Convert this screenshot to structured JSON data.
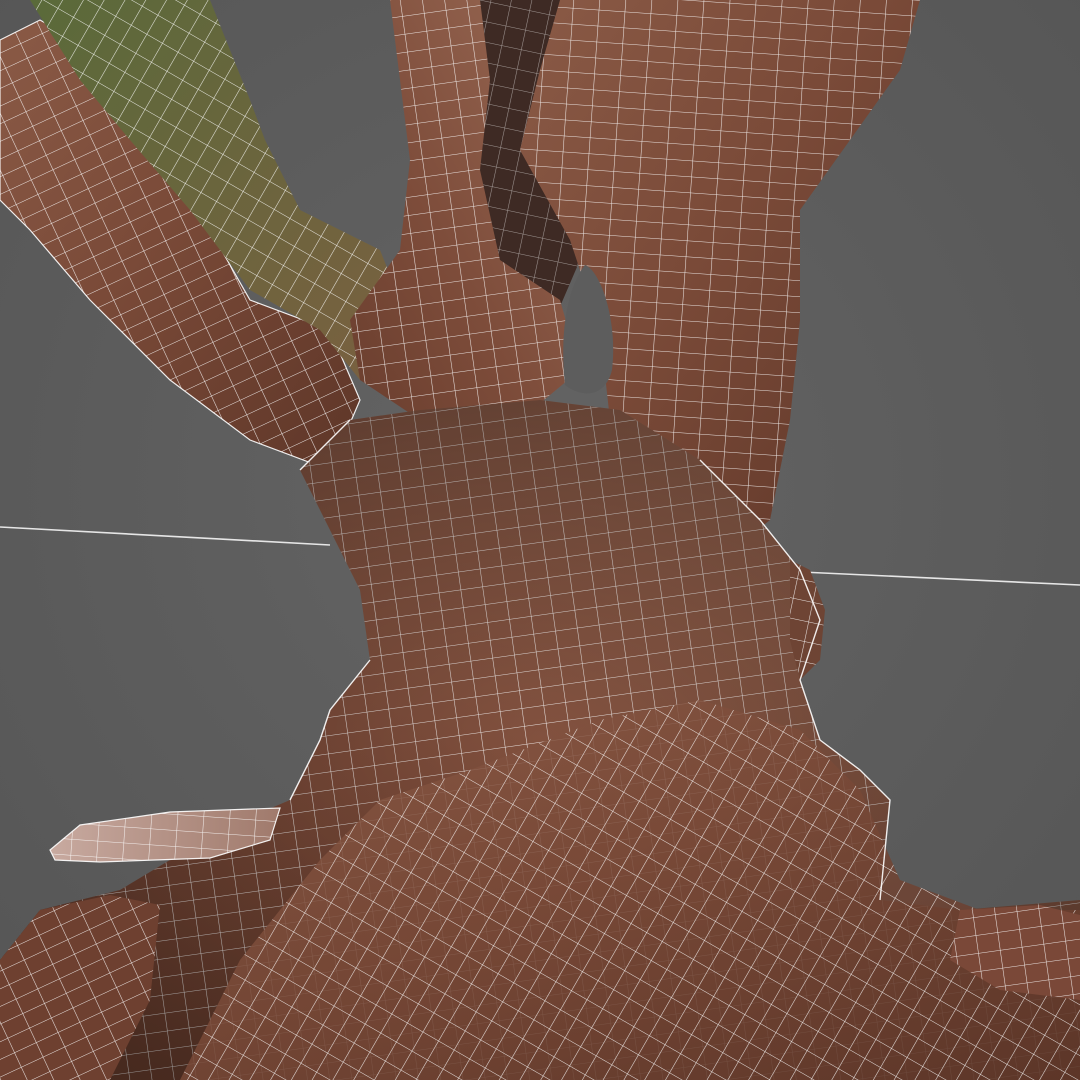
{
  "viewport": {
    "background_color": "#5b5b5b",
    "horizon_line_color": "#e6e6e6",
    "wireframe_color": "#ffffff"
  },
  "model": {
    "bark_base_color": "#7a4a38",
    "bark_dark_color": "#4a2a20",
    "bark_light_color": "#9a6a55",
    "moss_color": "#6b7040",
    "root_pale_color": "#b89a90",
    "wireframe_opacity": 0.85
  }
}
